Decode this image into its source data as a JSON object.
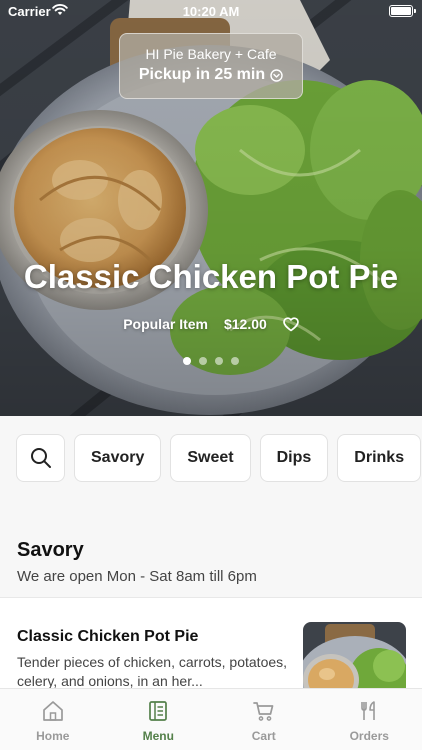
{
  "status_bar": {
    "carrier": "Carrier",
    "time": "10:20 AM"
  },
  "pickup": {
    "store_name": "HI Pie Bakery + Cafe",
    "pickup_text": "Pickup in 25 min"
  },
  "hero": {
    "title": "Classic Chicken Pot Pie",
    "badge": "Popular Item",
    "price": "$12.00",
    "carousel_total": 4,
    "carousel_active": 1
  },
  "categories": {
    "search_icon": "search-icon",
    "items": [
      "Savory",
      "Sweet",
      "Dips",
      "Drinks"
    ]
  },
  "section": {
    "title": "Savory",
    "subtitle": "We are open Mon - Sat 8am till 6pm"
  },
  "menu_items": [
    {
      "name": "Classic Chicken Pot Pie",
      "description": "Tender pieces of chicken, carrots, potatoes, celery, and onions, in an her..."
    }
  ],
  "tab_bar": {
    "tabs": [
      {
        "label": "Home",
        "icon": "home-icon"
      },
      {
        "label": "Menu",
        "icon": "menu-book-icon"
      },
      {
        "label": "Cart",
        "icon": "cart-icon"
      },
      {
        "label": "Orders",
        "icon": "fork-knife-icon"
      }
    ],
    "active_index": 1,
    "active_color": "#54804a",
    "inactive_color": "#9a9a9a"
  }
}
